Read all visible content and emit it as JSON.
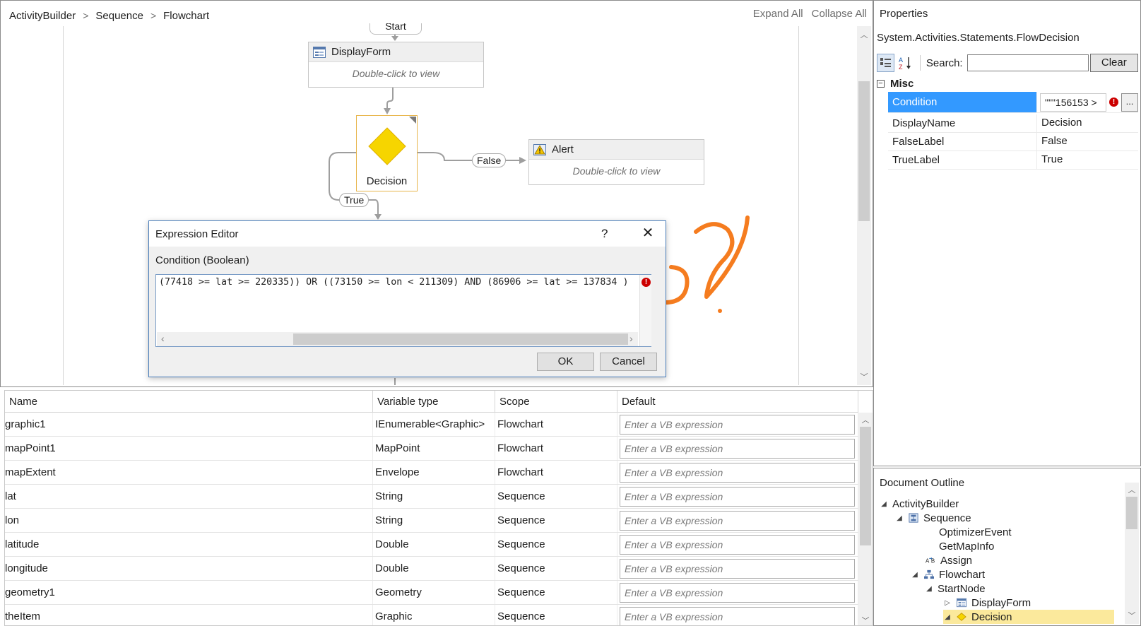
{
  "breadcrumb": [
    "ActivityBuilder",
    "Sequence",
    "Flowchart"
  ],
  "breadcrumb_sep": ">",
  "toolbar": {
    "expand_all": "Expand All",
    "collapse_all": "Collapse All"
  },
  "flowchart": {
    "start_label": "Start",
    "displayform": {
      "title": "DisplayForm",
      "hint": "Double-click to view"
    },
    "decision": {
      "label": "Decision"
    },
    "false_label": "False",
    "true_label": "True",
    "alert": {
      "title": "Alert",
      "hint": "Double-click to view"
    }
  },
  "dialog": {
    "title": "Expression Editor",
    "help": "?",
    "close": "✕",
    "condition_label": "Condition (Boolean)",
    "expression": "(77418 >= lat >= 220335)) OR ((73150 >= lon < 211309) AND (86906 >= lat >= 137834 )",
    "ok": "OK",
    "cancel": "Cancel"
  },
  "variables": {
    "headers": [
      "Name",
      "Variable type",
      "Scope",
      "Default"
    ],
    "placeholder": "Enter a VB expression",
    "rows": [
      {
        "name": "graphic1",
        "type": "IEnumerable<Graphic>",
        "scope": "Flowchart"
      },
      {
        "name": "mapPoint1",
        "type": "MapPoint",
        "scope": "Flowchart"
      },
      {
        "name": "mapExtent",
        "type": "Envelope",
        "scope": "Flowchart"
      },
      {
        "name": "lat",
        "type": "String",
        "scope": "Sequence"
      },
      {
        "name": "lon",
        "type": "String",
        "scope": "Sequence"
      },
      {
        "name": "latitude",
        "type": "Double",
        "scope": "Sequence"
      },
      {
        "name": "longitude",
        "type": "Double",
        "scope": "Sequence"
      },
      {
        "name": "geometry1",
        "type": "Geometry",
        "scope": "Sequence"
      },
      {
        "name": "theItem",
        "type": "Graphic",
        "scope": "Sequence"
      }
    ]
  },
  "properties": {
    "title": "Properties",
    "type_name": "System.Activities.Statements.FlowDecision",
    "search_label": "Search:",
    "search_value": "",
    "clear": "Clear",
    "section": "Misc",
    "rows": [
      {
        "name": "Condition",
        "value": "\"\"\"156153 >"
      },
      {
        "name": "DisplayName",
        "value": "Decision"
      },
      {
        "name": "FalseLabel",
        "value": "False"
      },
      {
        "name": "TrueLabel",
        "value": "True"
      }
    ],
    "ellipsis": "..."
  },
  "outline": {
    "title": "Document Outline",
    "items": [
      {
        "label": "ActivityBuilder"
      },
      {
        "label": "Sequence"
      },
      {
        "label": "OptimizerEvent"
      },
      {
        "label": "GetMapInfo"
      },
      {
        "label": "Assign"
      },
      {
        "label": "Flowchart"
      },
      {
        "label": "StartNode"
      },
      {
        "label": "DisplayForm"
      },
      {
        "label": "Decision"
      }
    ]
  },
  "colors": {
    "accent": "#3399ff",
    "annotation": "#f57c1f",
    "decision_fill": "#f6d500",
    "error": "#cc0000"
  }
}
